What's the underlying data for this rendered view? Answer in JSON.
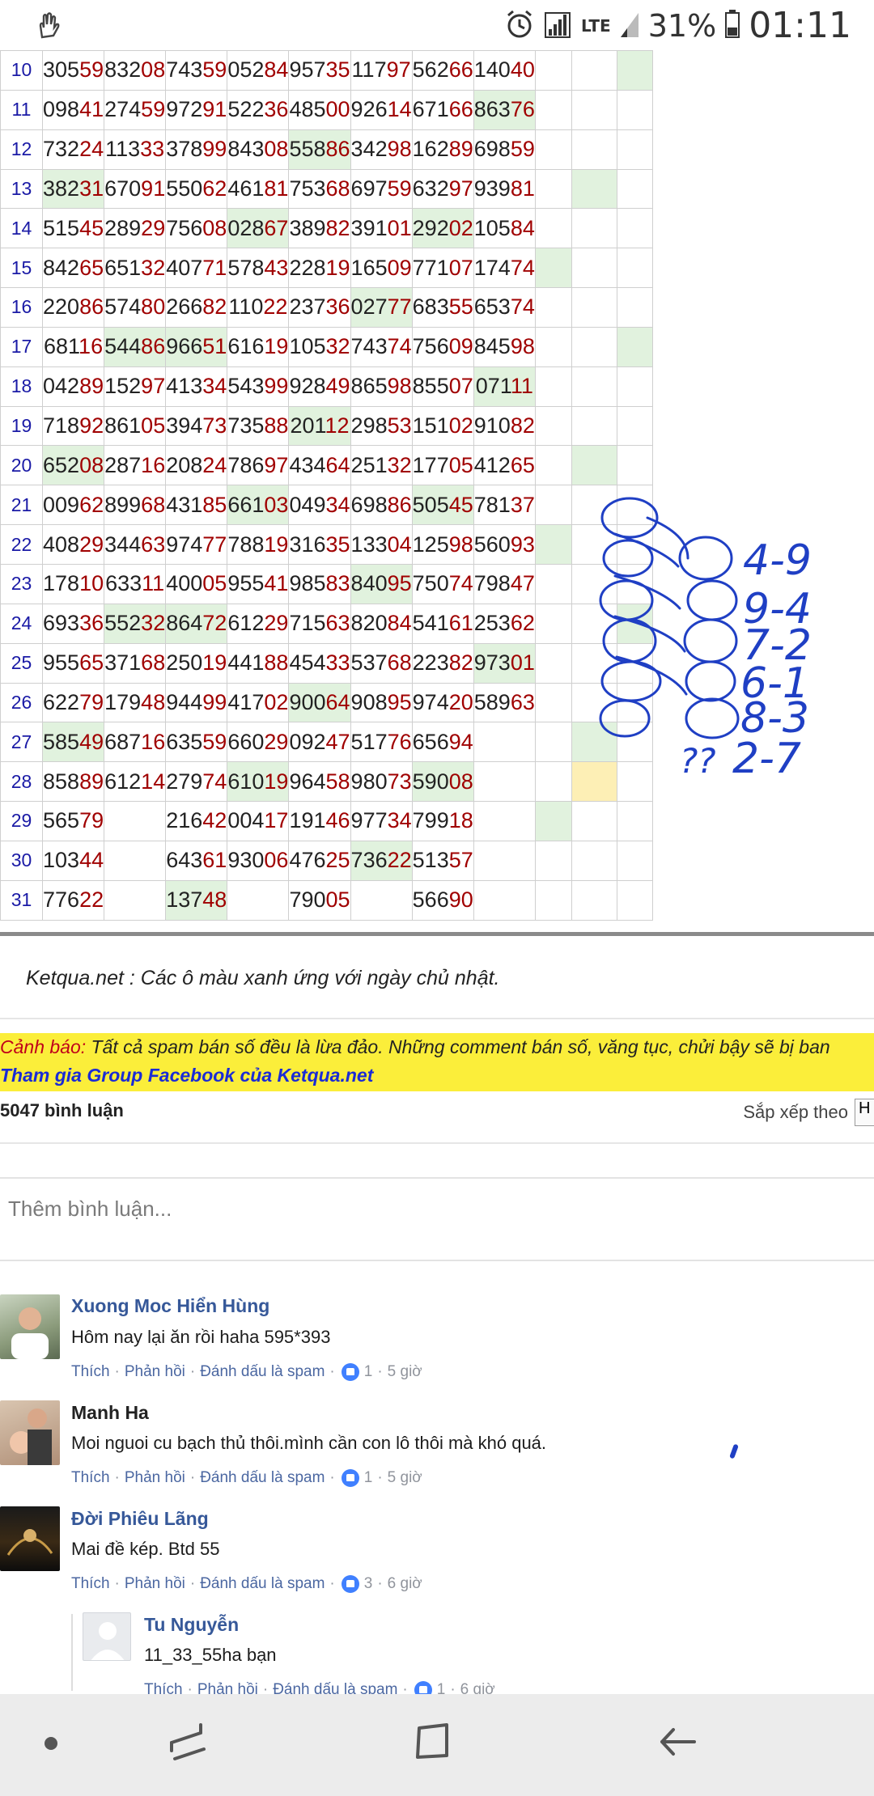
{
  "status_bar": {
    "network_label": "LTE",
    "battery_percent": "31%",
    "time": "01:11",
    "icons": [
      "hand-notification-icon",
      "alarm-icon",
      "signal-icon",
      "signal-icon-weak",
      "battery-icon"
    ]
  },
  "table": {
    "rows": [
      {
        "day": "10",
        "cells": [
          [
            "305",
            "59"
          ],
          [
            "832",
            "08"
          ],
          [
            "743",
            "59"
          ],
          [
            "052",
            "84"
          ],
          [
            "957",
            "35"
          ],
          [
            "117",
            "97"
          ],
          [
            "562",
            "66"
          ],
          [
            "140",
            "40"
          ],
          [
            "",
            ""
          ],
          [
            "",
            ""
          ],
          [
            "",
            ""
          ]
        ],
        "green": [
          10
        ]
      },
      {
        "day": "11",
        "cells": [
          [
            "098",
            "41"
          ],
          [
            "274",
            "59"
          ],
          [
            "972",
            "91"
          ],
          [
            "522",
            "36"
          ],
          [
            "485",
            "00"
          ],
          [
            "926",
            "14"
          ],
          [
            "671",
            "66"
          ],
          [
            "863",
            "76"
          ],
          [
            "",
            ""
          ],
          [
            "",
            ""
          ],
          [
            "",
            ""
          ]
        ],
        "green": [
          7
        ]
      },
      {
        "day": "12",
        "cells": [
          [
            "732",
            "24"
          ],
          [
            "113",
            "33"
          ],
          [
            "378",
            "99"
          ],
          [
            "843",
            "08"
          ],
          [
            "558",
            "86"
          ],
          [
            "342",
            "98"
          ],
          [
            "162",
            "89"
          ],
          [
            "698",
            "59"
          ],
          [
            "",
            ""
          ],
          [
            "",
            ""
          ],
          [
            "",
            ""
          ]
        ],
        "green": [
          4
        ]
      },
      {
        "day": "13",
        "cells": [
          [
            "382",
            "31"
          ],
          [
            "670",
            "91"
          ],
          [
            "550",
            "62"
          ],
          [
            "461",
            "81"
          ],
          [
            "753",
            "68"
          ],
          [
            "697",
            "59"
          ],
          [
            "632",
            "97"
          ],
          [
            "939",
            "81"
          ],
          [
            "",
            ""
          ],
          [
            "",
            ""
          ],
          [
            "",
            ""
          ]
        ],
        "green": [
          0,
          9
        ]
      },
      {
        "day": "14",
        "cells": [
          [
            "515",
            "45"
          ],
          [
            "289",
            "29"
          ],
          [
            "756",
            "08"
          ],
          [
            "028",
            "67"
          ],
          [
            "389",
            "82"
          ],
          [
            "391",
            "01"
          ],
          [
            "292",
            "02"
          ],
          [
            "105",
            "84"
          ],
          [
            "",
            ""
          ],
          [
            "",
            ""
          ],
          [
            "",
            ""
          ]
        ],
        "green": [
          3,
          6
        ]
      },
      {
        "day": "15",
        "cells": [
          [
            "842",
            "65"
          ],
          [
            "651",
            "32"
          ],
          [
            "407",
            "71"
          ],
          [
            "578",
            "43"
          ],
          [
            "228",
            "19"
          ],
          [
            "165",
            "09"
          ],
          [
            "771",
            "07"
          ],
          [
            "174",
            "74"
          ],
          [
            "",
            ""
          ],
          [
            "",
            ""
          ],
          [
            "",
            ""
          ]
        ],
        "green": [
          8
        ]
      },
      {
        "day": "16",
        "cells": [
          [
            "220",
            "86"
          ],
          [
            "574",
            "80"
          ],
          [
            "266",
            "82"
          ],
          [
            "110",
            "22"
          ],
          [
            "237",
            "36"
          ],
          [
            "027",
            "77"
          ],
          [
            "683",
            "55"
          ],
          [
            "653",
            "74"
          ],
          [
            "",
            ""
          ],
          [
            "",
            ""
          ],
          [
            "",
            ""
          ]
        ],
        "green": [
          5
        ]
      },
      {
        "day": "17",
        "cells": [
          [
            "681",
            "16"
          ],
          [
            "544",
            "86"
          ],
          [
            "966",
            "51"
          ],
          [
            "616",
            "19"
          ],
          [
            "105",
            "32"
          ],
          [
            "743",
            "74"
          ],
          [
            "756",
            "09"
          ],
          [
            "845",
            "98"
          ],
          [
            "",
            ""
          ],
          [
            "",
            ""
          ],
          [
            "",
            ""
          ]
        ],
        "green": [
          1,
          2,
          10
        ]
      },
      {
        "day": "18",
        "cells": [
          [
            "042",
            "89"
          ],
          [
            "152",
            "97"
          ],
          [
            "413",
            "34"
          ],
          [
            "543",
            "99"
          ],
          [
            "928",
            "49"
          ],
          [
            "865",
            "98"
          ],
          [
            "855",
            "07"
          ],
          [
            "071",
            "11"
          ],
          [
            "",
            ""
          ],
          [
            "",
            ""
          ],
          [
            "",
            ""
          ]
        ],
        "green": [
          7
        ]
      },
      {
        "day": "19",
        "cells": [
          [
            "718",
            "92"
          ],
          [
            "861",
            "05"
          ],
          [
            "394",
            "73"
          ],
          [
            "735",
            "88"
          ],
          [
            "201",
            "12"
          ],
          [
            "298",
            "53"
          ],
          [
            "151",
            "02"
          ],
          [
            "910",
            "82"
          ],
          [
            "",
            ""
          ],
          [
            "",
            ""
          ],
          [
            "",
            ""
          ]
        ],
        "green": [
          4
        ]
      },
      {
        "day": "20",
        "cells": [
          [
            "652",
            "08"
          ],
          [
            "287",
            "16"
          ],
          [
            "208",
            "24"
          ],
          [
            "786",
            "97"
          ],
          [
            "434",
            "64"
          ],
          [
            "251",
            "32"
          ],
          [
            "177",
            "05"
          ],
          [
            "412",
            "65"
          ],
          [
            "",
            ""
          ],
          [
            "",
            ""
          ],
          [
            "",
            ""
          ]
        ],
        "green": [
          0,
          9
        ]
      },
      {
        "day": "21",
        "cells": [
          [
            "009",
            "62"
          ],
          [
            "899",
            "68"
          ],
          [
            "431",
            "85"
          ],
          [
            "661",
            "03"
          ],
          [
            "049",
            "34"
          ],
          [
            "698",
            "86"
          ],
          [
            "505",
            "45"
          ],
          [
            "781",
            "37"
          ],
          [
            "",
            ""
          ],
          [
            "",
            ""
          ],
          [
            "",
            ""
          ]
        ],
        "green": [
          3,
          6
        ]
      },
      {
        "day": "22",
        "cells": [
          [
            "408",
            "29"
          ],
          [
            "344",
            "63"
          ],
          [
            "974",
            "77"
          ],
          [
            "788",
            "19"
          ],
          [
            "316",
            "35"
          ],
          [
            "133",
            "04"
          ],
          [
            "125",
            "98"
          ],
          [
            "560",
            "93"
          ],
          [
            "",
            ""
          ],
          [
            "",
            ""
          ],
          [
            "",
            ""
          ]
        ],
        "green": [
          8
        ]
      },
      {
        "day": "23",
        "cells": [
          [
            "178",
            "10"
          ],
          [
            "633",
            "11"
          ],
          [
            "400",
            "05"
          ],
          [
            "955",
            "41"
          ],
          [
            "985",
            "83"
          ],
          [
            "840",
            "95"
          ],
          [
            "750",
            "74"
          ],
          [
            "798",
            "47"
          ],
          [
            "",
            ""
          ],
          [
            "",
            ""
          ],
          [
            "",
            ""
          ]
        ],
        "green": [
          5
        ]
      },
      {
        "day": "24",
        "cells": [
          [
            "693",
            "36"
          ],
          [
            "552",
            "32"
          ],
          [
            "864",
            "72"
          ],
          [
            "612",
            "29"
          ],
          [
            "715",
            "63"
          ],
          [
            "820",
            "84"
          ],
          [
            "541",
            "61"
          ],
          [
            "253",
            "62"
          ],
          [
            "",
            ""
          ],
          [
            "",
            ""
          ],
          [
            "",
            ""
          ]
        ],
        "green": [
          1,
          2,
          10
        ]
      },
      {
        "day": "25",
        "cells": [
          [
            "955",
            "65"
          ],
          [
            "371",
            "68"
          ],
          [
            "250",
            "19"
          ],
          [
            "441",
            "88"
          ],
          [
            "454",
            "33"
          ],
          [
            "537",
            "68"
          ],
          [
            "223",
            "82"
          ],
          [
            "973",
            "01"
          ],
          [
            "",
            ""
          ],
          [
            "",
            ""
          ],
          [
            "",
            ""
          ]
        ],
        "green": [
          7
        ]
      },
      {
        "day": "26",
        "cells": [
          [
            "622",
            "79"
          ],
          [
            "179",
            "48"
          ],
          [
            "944",
            "99"
          ],
          [
            "417",
            "02"
          ],
          [
            "900",
            "64"
          ],
          [
            "908",
            "95"
          ],
          [
            "974",
            "20"
          ],
          [
            "589",
            "63"
          ],
          [
            "",
            ""
          ],
          [
            "",
            ""
          ],
          [
            "",
            ""
          ]
        ],
        "green": [
          4
        ]
      },
      {
        "day": "27",
        "cells": [
          [
            "585",
            "49"
          ],
          [
            "687",
            "16"
          ],
          [
            "635",
            "59"
          ],
          [
            "660",
            "29"
          ],
          [
            "092",
            "47"
          ],
          [
            "517",
            "76"
          ],
          [
            "656",
            "94"
          ],
          [
            "",
            ""
          ],
          [
            "",
            ""
          ],
          [
            "",
            ""
          ],
          [
            "",
            ""
          ]
        ],
        "green": [
          0,
          9
        ]
      },
      {
        "day": "28",
        "cells": [
          [
            "858",
            "89"
          ],
          [
            "612",
            "14"
          ],
          [
            "279",
            "74"
          ],
          [
            "610",
            "19"
          ],
          [
            "964",
            "58"
          ],
          [
            "980",
            "73"
          ],
          [
            "590",
            "08"
          ],
          [
            "",
            ""
          ],
          [
            "",
            ""
          ],
          [
            "",
            ""
          ],
          [
            "",
            ""
          ]
        ],
        "green": [
          3,
          6
        ],
        "yellow": [
          9
        ]
      },
      {
        "day": "29",
        "cells": [
          [
            "565",
            "79"
          ],
          [
            "",
            ""
          ],
          [
            "216",
            "42"
          ],
          [
            "004",
            "17"
          ],
          [
            "191",
            "46"
          ],
          [
            "977",
            "34"
          ],
          [
            "799",
            "18"
          ],
          [
            "",
            ""
          ],
          [
            "",
            ""
          ],
          [
            "",
            ""
          ],
          [
            "",
            ""
          ]
        ],
        "green": [
          8
        ]
      },
      {
        "day": "30",
        "cells": [
          [
            "103",
            "44"
          ],
          [
            "",
            ""
          ],
          [
            "643",
            "61"
          ],
          [
            "930",
            "06"
          ],
          [
            "476",
            "25"
          ],
          [
            "736",
            "22"
          ],
          [
            "513",
            "57"
          ],
          [
            "",
            ""
          ],
          [
            "",
            ""
          ],
          [
            "",
            ""
          ],
          [
            "",
            ""
          ]
        ],
        "green": [
          5
        ]
      },
      {
        "day": "31",
        "cells": [
          [
            "776",
            "22"
          ],
          [
            "",
            ""
          ],
          [
            "137",
            "48"
          ],
          [
            "",
            ""
          ],
          [
            "790",
            "05"
          ],
          [
            "",
            ""
          ],
          [
            "566",
            "90"
          ],
          [
            "",
            ""
          ],
          [
            "",
            ""
          ],
          [
            "",
            ""
          ],
          [
            "",
            ""
          ]
        ],
        "green": [
          2
        ]
      }
    ]
  },
  "handwriting": {
    "pairs": [
      "4-9",
      "9-4",
      "7-2",
      "6-1",
      "8-3",
      "2-7"
    ],
    "question": "??"
  },
  "note": "Ketqua.net : Các ô màu xanh ứng với ngày chủ nhật.",
  "warning": {
    "label": "Cảnh báo:",
    "text": " Tất cả spam bán số đều là lừa đảo. Những comment bán số, văng tục, chửi bậy sẽ bị ban",
    "group_link": "Tham gia Group Facebook của Ketqua.net"
  },
  "comments_header": {
    "count": "5047 bình luận",
    "sort_label": "Sắp xếp theo",
    "sort_value": "H"
  },
  "add_comment_placeholder": "Thêm bình luận...",
  "action_labels": {
    "like": "Thích",
    "reply": "Phản hồi",
    "spam": "Đánh dấu là spam"
  },
  "comments": [
    {
      "name": "Xuong Moc Hiển Hùng",
      "text": "Hôm nay lại ăn rồi haha 595*393",
      "likes": "1",
      "time": "5 giờ"
    },
    {
      "name": "Manh Ha",
      "text": "Moi nguoi cu bạch thủ thôi.mình cần con lô thôi mà khó quá.",
      "likes": "1",
      "time": "5 giờ"
    },
    {
      "name": "Đời Phiêu Lãng",
      "text": "Mai đề kép. Btd 55",
      "likes": "3",
      "time": "6 giờ"
    },
    {
      "name": "Tu Nguyễn",
      "text": "11_33_55ha bạn",
      "likes": "1",
      "time": "6 giờ"
    }
  ],
  "colors": {
    "green_cell": "#e1f2de",
    "yellow_cell": "#fdefb5",
    "day_number": "#1a1aa6",
    "tail_digits": "#a00000",
    "warning_bg": "#fbee3a",
    "link_blue": "#365899",
    "ink": "#1f3fc4"
  }
}
